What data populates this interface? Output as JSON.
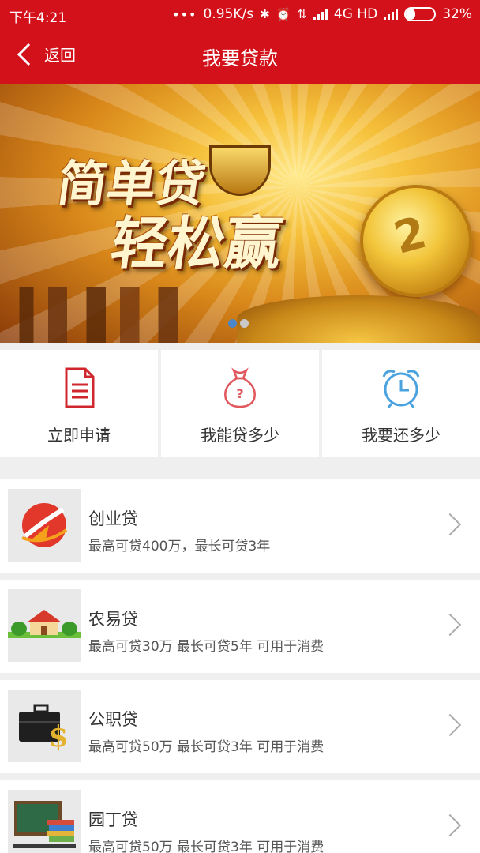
{
  "status_bar": {
    "time": "下午4:21",
    "dots": "•••",
    "net_speed": "0.95K/s",
    "network": "4G HD",
    "battery": "32%",
    "battery_level": 0.32
  },
  "header": {
    "back_label": "返回",
    "title": "我要贷款",
    "bg_color": "#d3111a"
  },
  "banner": {
    "line1": "简单贷",
    "line2": "轻松赢",
    "coin_mark": "2",
    "slide_count": 2,
    "active_slide": 1
  },
  "quick_actions": [
    {
      "label": "立即申请",
      "icon": "document-icon"
    },
    {
      "label": "我能贷多少",
      "icon": "money-bag-icon"
    },
    {
      "label": "我要还多少",
      "icon": "alarm-clock-icon"
    }
  ],
  "loans": [
    {
      "name": "创业贷",
      "desc": "最高可贷400万，最长可贷3年",
      "icon": "startup-logo-icon"
    },
    {
      "name": "农易贷",
      "desc": "最高可贷30万 最长可贷5年 可用于消费",
      "icon": "farmhouse-icon"
    },
    {
      "name": "公职贷",
      "desc": "最高可贷50万 最长可贷3年 可用于消费",
      "icon": "briefcase-dollar-icon"
    },
    {
      "name": "园丁贷",
      "desc": "最高可贷50万 最长可贷3年 可用于消费",
      "icon": "blackboard-books-icon"
    }
  ]
}
